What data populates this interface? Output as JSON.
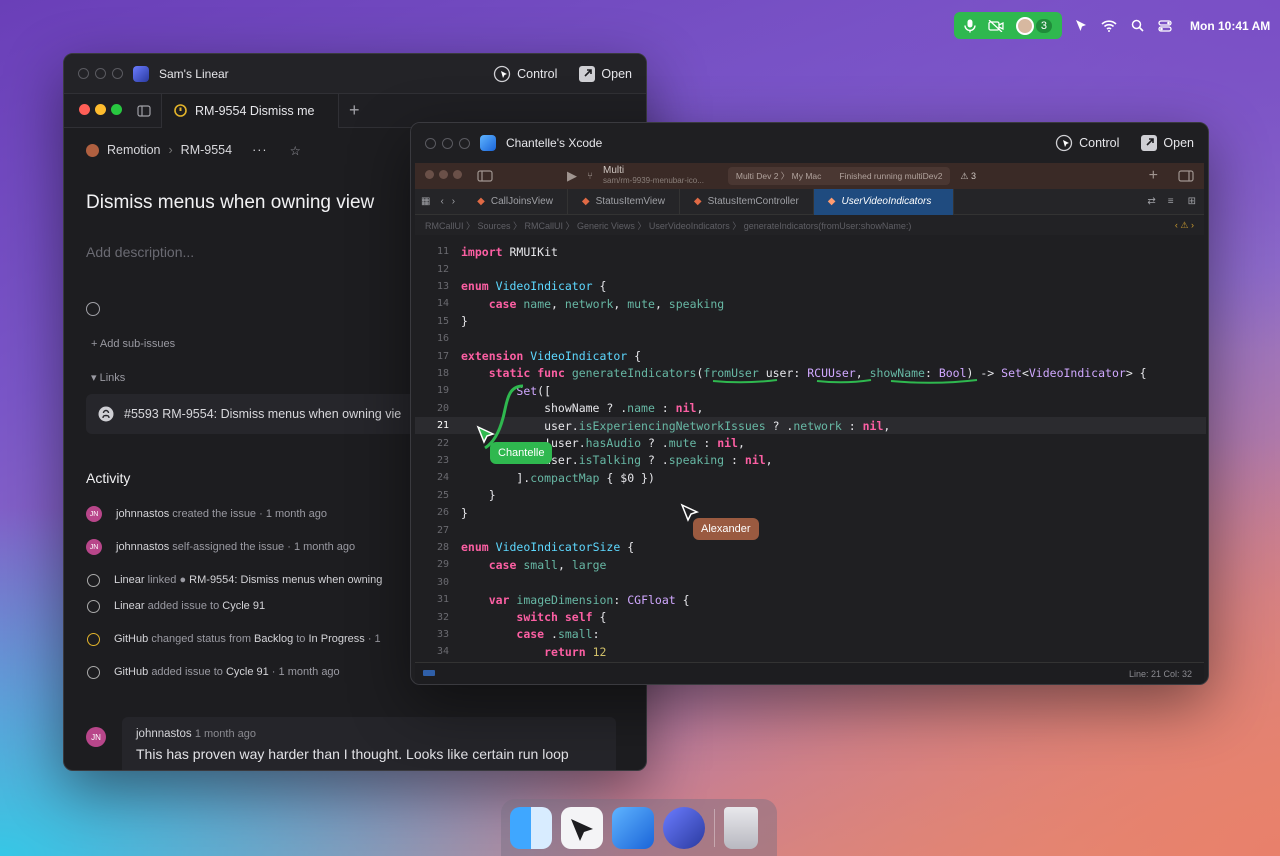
{
  "menubar": {
    "participants_count": "3",
    "clock": "Mon 10:41 AM",
    "icons": [
      "microphone-icon",
      "camera-off-icon",
      "cursor-icon",
      "wifi-icon",
      "search-icon",
      "control-center-icon"
    ]
  },
  "linear_window": {
    "title": "Sam's Linear",
    "control_label": "Control",
    "open_label": "Open",
    "tab_label": "RM-9554 Dismiss me",
    "breadcrumb": {
      "team": "Remotion",
      "issue_id": "RM-9554"
    },
    "issue_title": "Dismiss menus when owning view",
    "description_placeholder": "Add description...",
    "add_sub_issues": "+ Add sub-issues",
    "links_label": "Links",
    "link_title": "#5593 RM-9554: Dismiss menus when owning vie",
    "activity_heading": "Activity",
    "activity": [
      {
        "actor": "johnnastos",
        "action": "created the issue",
        "time": "· 1 month ago",
        "avatar": "JN"
      },
      {
        "actor": "johnnastos",
        "action": "self-assigned the issue",
        "time": "· 1 month ago",
        "avatar": "JN"
      },
      {
        "actor": "Linear",
        "action": "linked",
        "target": "RM-9554: Dismiss menus when owning"
      },
      {
        "actor": "Linear",
        "action": "added issue to",
        "target": "Cycle 91"
      },
      {
        "actor": "GitHub",
        "action": "changed status from",
        "from": "Backlog",
        "to_word": "to",
        "to": "In Progress",
        "time": "· 1"
      },
      {
        "actor": "GitHub",
        "action": "added issue to",
        "target": "Cycle 91",
        "time": "· 1 month ago"
      }
    ],
    "comment": {
      "author": "johnnastos",
      "time": "1 month ago",
      "avatar": "JN",
      "body": "This has proven way harder than I thought. Looks like certain run loop"
    }
  },
  "xcode_window": {
    "title": "Chantelle's Xcode",
    "control_label": "Control",
    "open_label": "Open",
    "scheme": "Multi",
    "branch": "sam/rm-9939-menubar-ico...",
    "destination": "Multi Dev 2 〉 My Mac",
    "run_status": "Finished running multiDev2",
    "warnings": "3",
    "tabs": [
      "CallJoinsView",
      "StatusItemView",
      "StatusItemController",
      "UserVideoIndicators"
    ],
    "active_tab": "UserVideoIndicators",
    "jump_bar": "RMCallUI 〉 Sources 〉 RMCallUI 〉 Generic Views 〉 UserVideoIndicators 〉 generateIndicators(fromUser:showName:)",
    "status_bar": "Line: 21  Col: 32",
    "code_lines": [
      {
        "n": "11",
        "html_key": "l11"
      },
      {
        "n": "12"
      },
      {
        "n": "13"
      },
      {
        "n": "14"
      },
      {
        "n": "15"
      },
      {
        "n": "16"
      },
      {
        "n": "17"
      },
      {
        "n": "18"
      },
      {
        "n": "19"
      },
      {
        "n": "20"
      },
      {
        "n": "21"
      },
      {
        "n": "22"
      },
      {
        "n": "23"
      },
      {
        "n": "24"
      },
      {
        "n": "25"
      },
      {
        "n": "26"
      },
      {
        "n": "27"
      },
      {
        "n": "28"
      },
      {
        "n": "29"
      },
      {
        "n": "30"
      },
      {
        "n": "31"
      },
      {
        "n": "32"
      },
      {
        "n": "33"
      },
      {
        "n": "34"
      }
    ]
  },
  "cursors": [
    {
      "name": "Chantelle",
      "color": "#2fb84f"
    },
    {
      "name": "Alexander",
      "color": "#9a5a40"
    }
  ],
  "dock": [
    "finder-icon",
    "remotion-icon",
    "xcode-icon",
    "linear-icon",
    "trash-icon"
  ]
}
